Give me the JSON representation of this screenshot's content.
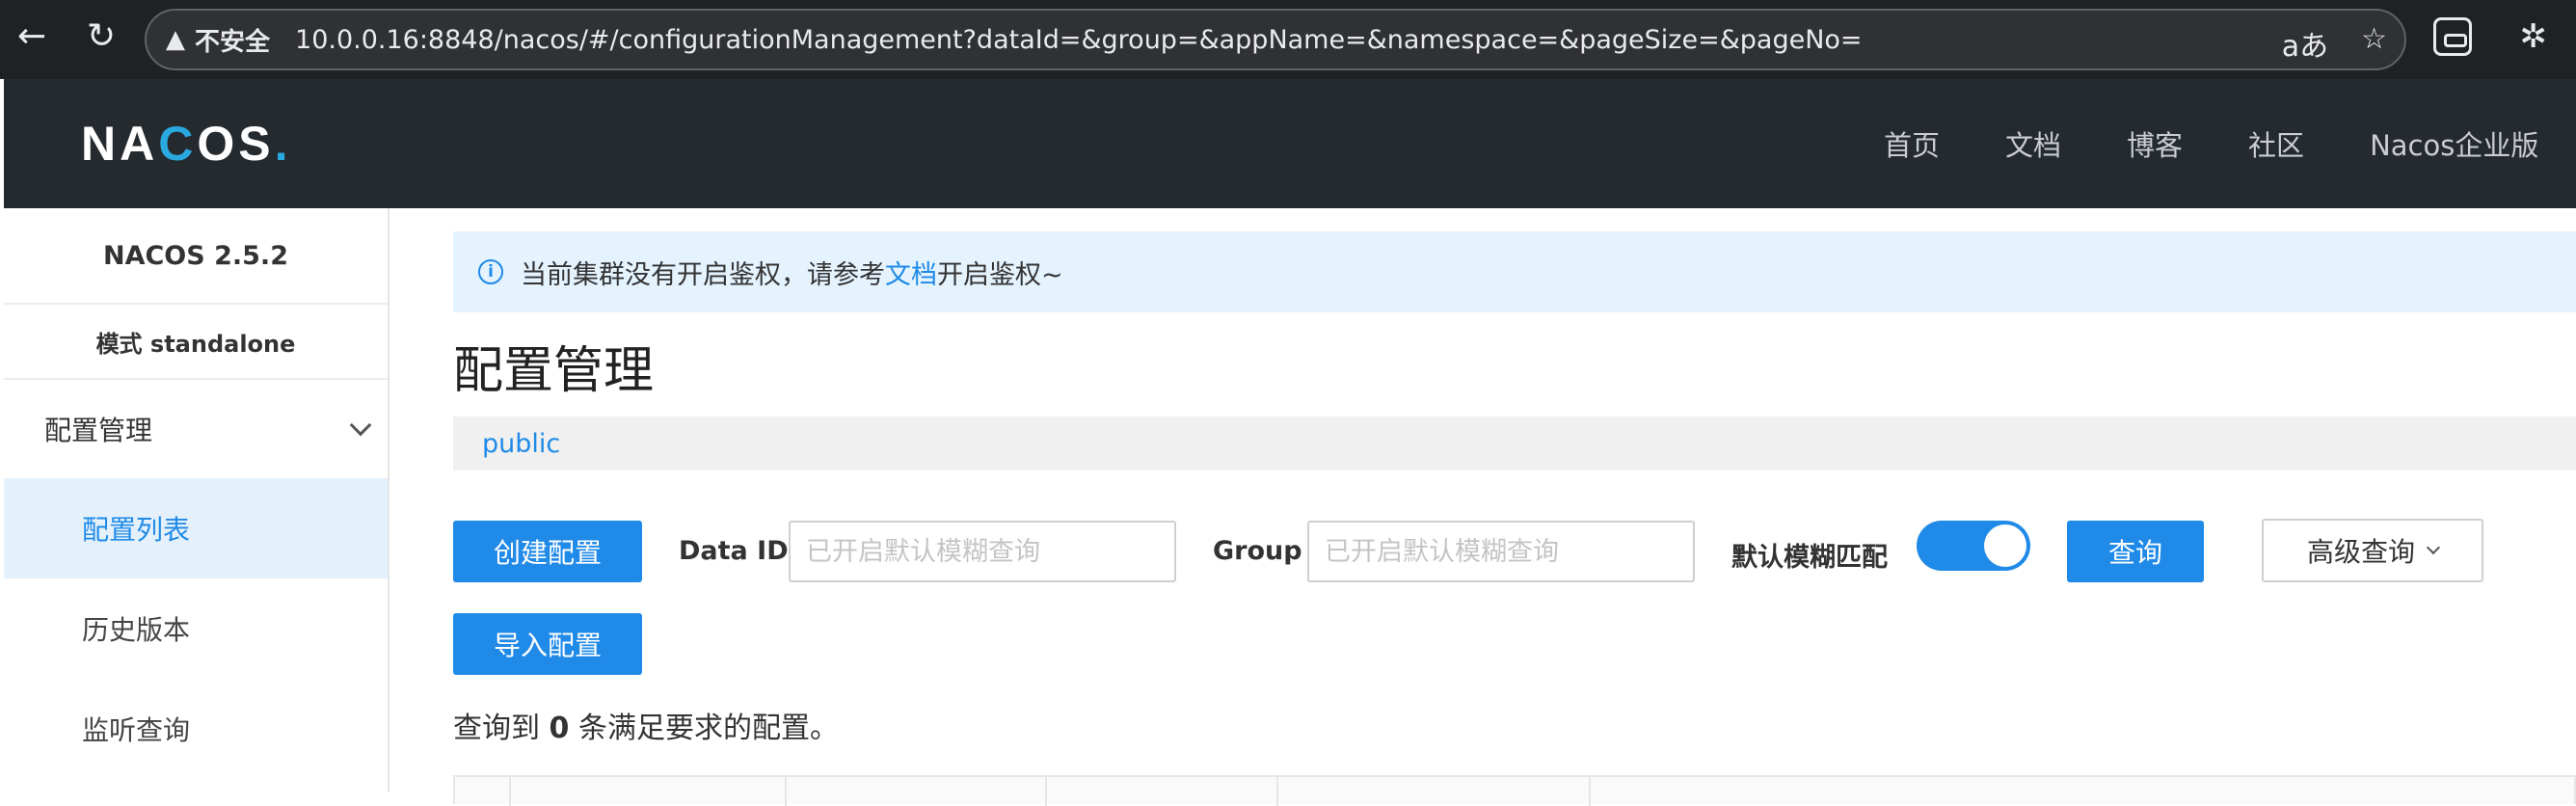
{
  "browser": {
    "not_secure": "不安全",
    "url": "10.0.0.16:8848/nacos/#/configurationManagement?dataId=&group=&appName=&namespace=&pageSize=&pageNo=",
    "back_glyph": "←",
    "reload_glyph": "↻",
    "warn_glyph": "▲",
    "translate_glyph": "aあ",
    "star_glyph": "☆",
    "ext_glyph": "✲"
  },
  "header": {
    "logo_pre": "NA",
    "logo_accent": "C",
    "logo_post": "OS",
    "logo_dot": ".",
    "nav": [
      "首页",
      "文档",
      "博客",
      "社区",
      "Nacos企业版"
    ]
  },
  "sidebar": {
    "version": "NACOS 2.5.2",
    "mode": "模式 standalone",
    "group_label": "配置管理",
    "items": [
      "配置列表",
      "历史版本",
      "监听查询"
    ]
  },
  "main": {
    "notice_pre": "当前集群没有开启鉴权，请参考",
    "notice_link": "文档",
    "notice_post": "开启鉴权~",
    "notice_icon": "i",
    "title": "配置管理",
    "namespace": "public",
    "create_button": "创建配置",
    "import_button": "导入配置",
    "dataid_label": "Data ID",
    "dataid_placeholder": "已开启默认模糊查询",
    "group_label": "Group",
    "group_placeholder": "已开启默认模糊查询",
    "fuzzy_label": "默认模糊匹配",
    "fuzzy_enabled": true,
    "query_button": "查询",
    "advanced_button": "高级查询",
    "result_pre": "查询到 ",
    "result_count": "0",
    "result_post": " 条满足要求的配置。"
  },
  "colors": {
    "primary": "#1f8ae8",
    "header_bg": "#252a2f",
    "notice_bg": "#e5f3ff"
  }
}
